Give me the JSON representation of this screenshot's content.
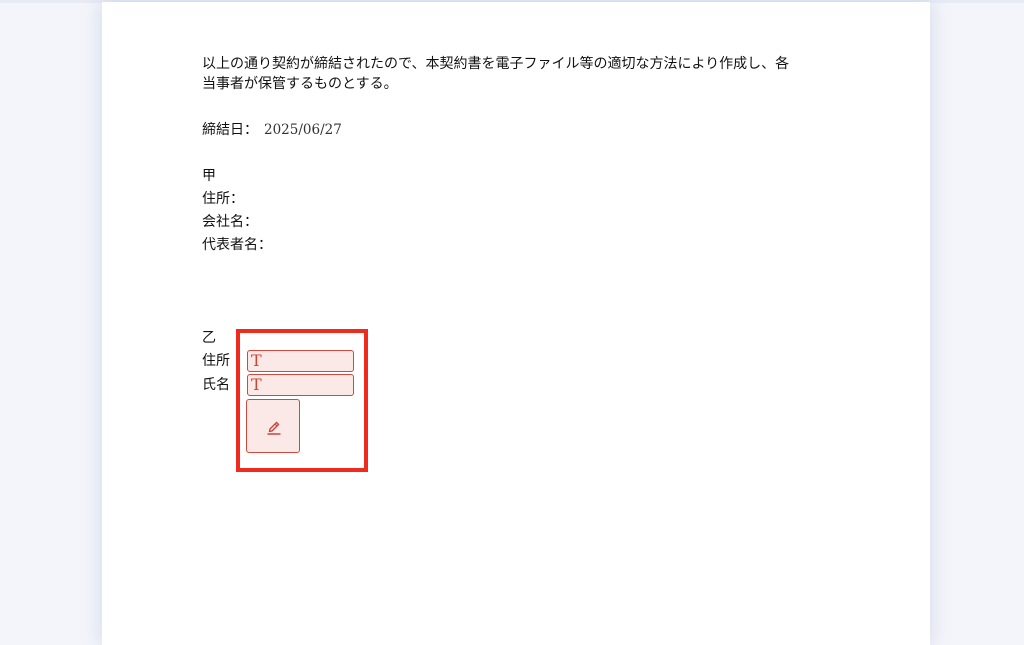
{
  "document": {
    "closing_paragraph_line1": "以上の通り契約が締結されたので、本契約書を電子ファイル等の適切な方法により作成し、各",
    "closing_paragraph_line2": "当事者が保管するものとする。",
    "date_label": "締結日：",
    "date_value": "2025/06/27",
    "party_a": {
      "heading": "甲",
      "address_label": "住所：",
      "company_label": "会社名：",
      "representative_label": "代表者名："
    },
    "party_b": {
      "heading": "乙",
      "address_label": "住所",
      "name_label": "氏名"
    }
  },
  "fields": {
    "text_field_icon": "text-T-icon",
    "text_field_glyph": "T",
    "signature_field_icon": "pen-icon"
  },
  "colors": {
    "highlight_border": "#ee2b1d",
    "field_border": "#d0493c",
    "field_fill": "#fbe9e7"
  }
}
